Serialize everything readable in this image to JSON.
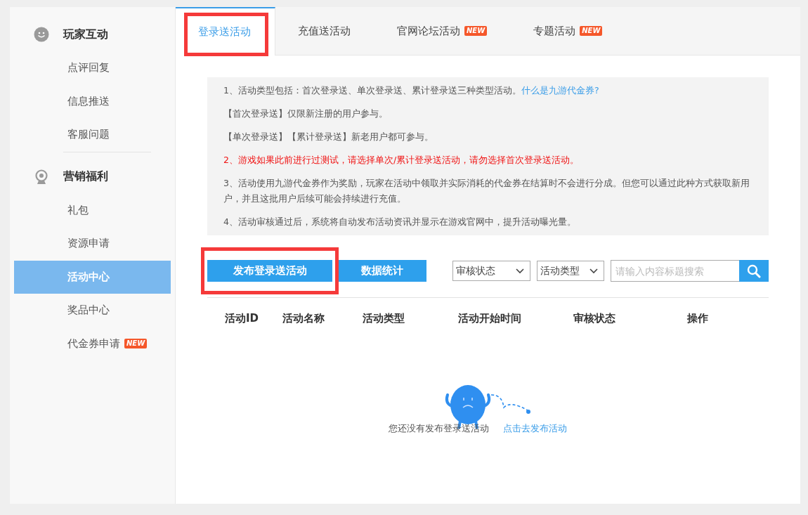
{
  "sidebar": {
    "groups": [
      {
        "title": "玩家互动",
        "items": [
          {
            "label": "点评回复",
            "selected": false
          },
          {
            "label": "信息推送",
            "selected": false
          },
          {
            "label": "客服问题",
            "selected": false
          }
        ]
      },
      {
        "title": "营销福利",
        "items": [
          {
            "label": "礼包",
            "selected": false
          },
          {
            "label": "资源申请",
            "selected": false
          },
          {
            "label": "活动中心",
            "selected": true
          },
          {
            "label": "奖品中心",
            "selected": false
          },
          {
            "label": "代金券申请",
            "selected": false,
            "badge": "NEW"
          }
        ]
      }
    ]
  },
  "tabs": [
    {
      "label": "登录送活动",
      "selected": true,
      "highlighted": true
    },
    {
      "label": "充值送活动",
      "selected": false,
      "highlighted": false
    },
    {
      "label": "官网论坛活动",
      "selected": false,
      "highlighted": false,
      "badge": "NEW"
    },
    {
      "label": "专题活动",
      "selected": false,
      "highlighted": false,
      "badge": "NEW"
    }
  ],
  "notice": [
    {
      "kind": "link",
      "text": "1、活动类型包括：首次登录送、单次登录送、累计登录送三种类型活动。",
      "link": "什么是九游代金券?"
    },
    {
      "kind": "plain",
      "text": "【首次登录送】仅限新注册的用户参与。"
    },
    {
      "kind": "plain",
      "text": "【单次登录送】【累计登录送】新老用户都可参与。"
    },
    {
      "kind": "warning",
      "text": "2、游戏如果此前进行过测试，请选择单次/累计登录送活动，请勿选择首次登录送活动。"
    },
    {
      "kind": "plain",
      "text": "3、活动使用九游代金券作为奖励，玩家在活动中领取并实际消耗的代金券在结算时不会进行分成。但您可以通过此种方式获取新用户，并且这批用户后续可能会持续进行充值。"
    },
    {
      "kind": "plain",
      "text": "4、活动审核通过后，系统将自动发布活动资讯并显示在游戏官网中，提升活动曝光量。"
    }
  ],
  "toolbar": {
    "buttons": [
      {
        "label": "发布登录送活动",
        "highlighted": true
      },
      {
        "label": "数据统计",
        "highlighted": false
      }
    ],
    "filters": [
      {
        "value": "审核状态"
      },
      {
        "value": "活动类型"
      }
    ],
    "search": {
      "placeholder": "请输入内容标题搜索"
    }
  },
  "table": {
    "columns": [
      "活动ID",
      "活动名称",
      "活动类型",
      "活动开始时间",
      "审核状态",
      "操作"
    ]
  },
  "empty_state": {
    "message": "您还没有发布登录送活动",
    "link": "点击去发布活动"
  }
}
